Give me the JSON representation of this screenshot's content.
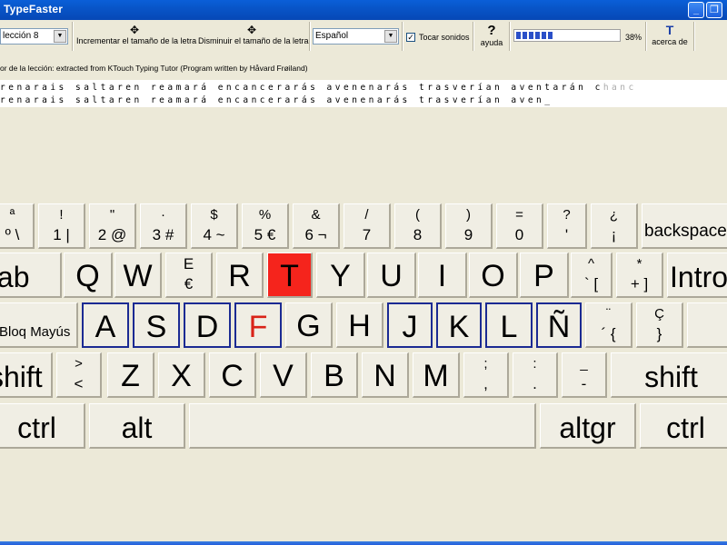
{
  "window": {
    "title": "TypeFaster"
  },
  "toolbar": {
    "lesson_select": "lección 8",
    "increase_font_label": "Incrementar el tamaño de la letra",
    "decrease_font_label": "Disminuir el tamaño de la letra",
    "language_select": "Español",
    "sound_label": "Tocar sonidos",
    "sound_checked": true,
    "help_label": "ayuda",
    "progress_percent_label": "38%",
    "progress_value": 0.38,
    "about_label": "acerca de"
  },
  "lesson": {
    "author_line": "or de la lección: extracted from KTouch Typing Tutor (Program written by Håvard Frøiland)",
    "target_text": "renarais saltaren reamará encancerarás avenenarás trasverían aventarán c",
    "target_next": "hanc",
    "typed_text": "renarais saltaren reamará encancerarás avenenarás trasverían aven_"
  },
  "keyboard": {
    "row1": [
      {
        "top": "ª",
        "bottom": "º \\"
      },
      {
        "top": "!",
        "bottom": "1 |"
      },
      {
        "top": "\"",
        "bottom": "2 @"
      },
      {
        "top": "·",
        "bottom": "3 #"
      },
      {
        "top": "$",
        "bottom": "4 ~"
      },
      {
        "top": "%",
        "bottom": "5 €"
      },
      {
        "top": "&",
        "bottom": "6 ¬"
      },
      {
        "top": "/",
        "bottom": "7"
      },
      {
        "top": "(",
        "bottom": "8"
      },
      {
        "top": ")",
        "bottom": "9"
      },
      {
        "top": "=",
        "bottom": "0"
      },
      {
        "top": "?",
        "bottom": "'"
      },
      {
        "top": "¿",
        "bottom": "¡"
      }
    ],
    "backspace": "backspace",
    "tab": "tab",
    "row2": [
      "Q",
      "W",
      "E",
      "R",
      "T",
      "Y",
      "U",
      "I",
      "O",
      "P"
    ],
    "row2_e_alt": "€",
    "row2_extra": [
      {
        "top": "^",
        "bottom": "` ["
      },
      {
        "top": "*",
        "bottom": "+ ]"
      }
    ],
    "enter": "Intro",
    "caps": "Bloq Mayús",
    "row3": [
      "A",
      "S",
      "D",
      "F",
      "G",
      "H",
      "J",
      "K",
      "L",
      "Ñ"
    ],
    "row3_extra": [
      {
        "top": "¨",
        "bottom": "´ {"
      },
      {
        "top": "Ç",
        "bottom": "}"
      }
    ],
    "shift_left": "shift",
    "angle_key": {
      "top": ">",
      "bottom": "<"
    },
    "row4": [
      "Z",
      "X",
      "C",
      "V",
      "B",
      "N",
      "M"
    ],
    "row4_extra": [
      {
        "top": ";",
        "bottom": ","
      },
      {
        "top": ":",
        "bottom": "."
      },
      {
        "top": "_",
        "bottom": "-"
      }
    ],
    "shift_right": "shift",
    "ctrl_left": "ctrl",
    "alt": "alt",
    "altgr": "altgr",
    "ctrl_right": "ctrl",
    "active_key": "T",
    "colors": {
      "active": "#f5241c",
      "home_border": "#1b2a93",
      "highlight_text": "#d92318"
    }
  }
}
